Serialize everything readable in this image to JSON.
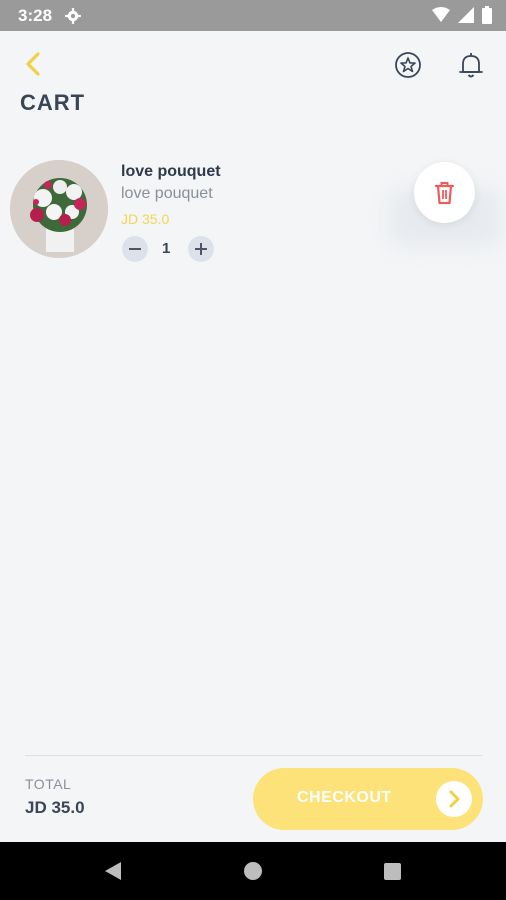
{
  "status_bar": {
    "time": "3:28"
  },
  "header": {
    "title": "CART"
  },
  "cart": {
    "items": [
      {
        "name": "love pouquet",
        "subtitle": "love pouquet",
        "price": "JD 35.0",
        "quantity": "1"
      }
    ]
  },
  "footer": {
    "total_label": "TOTAL",
    "total_value": "JD 35.0",
    "checkout_label": "CHECKOUT"
  },
  "colors": {
    "accent": "#fde27a",
    "price": "#f6d454",
    "delete": "#ee5b5b",
    "background": "#f3f5f7"
  }
}
